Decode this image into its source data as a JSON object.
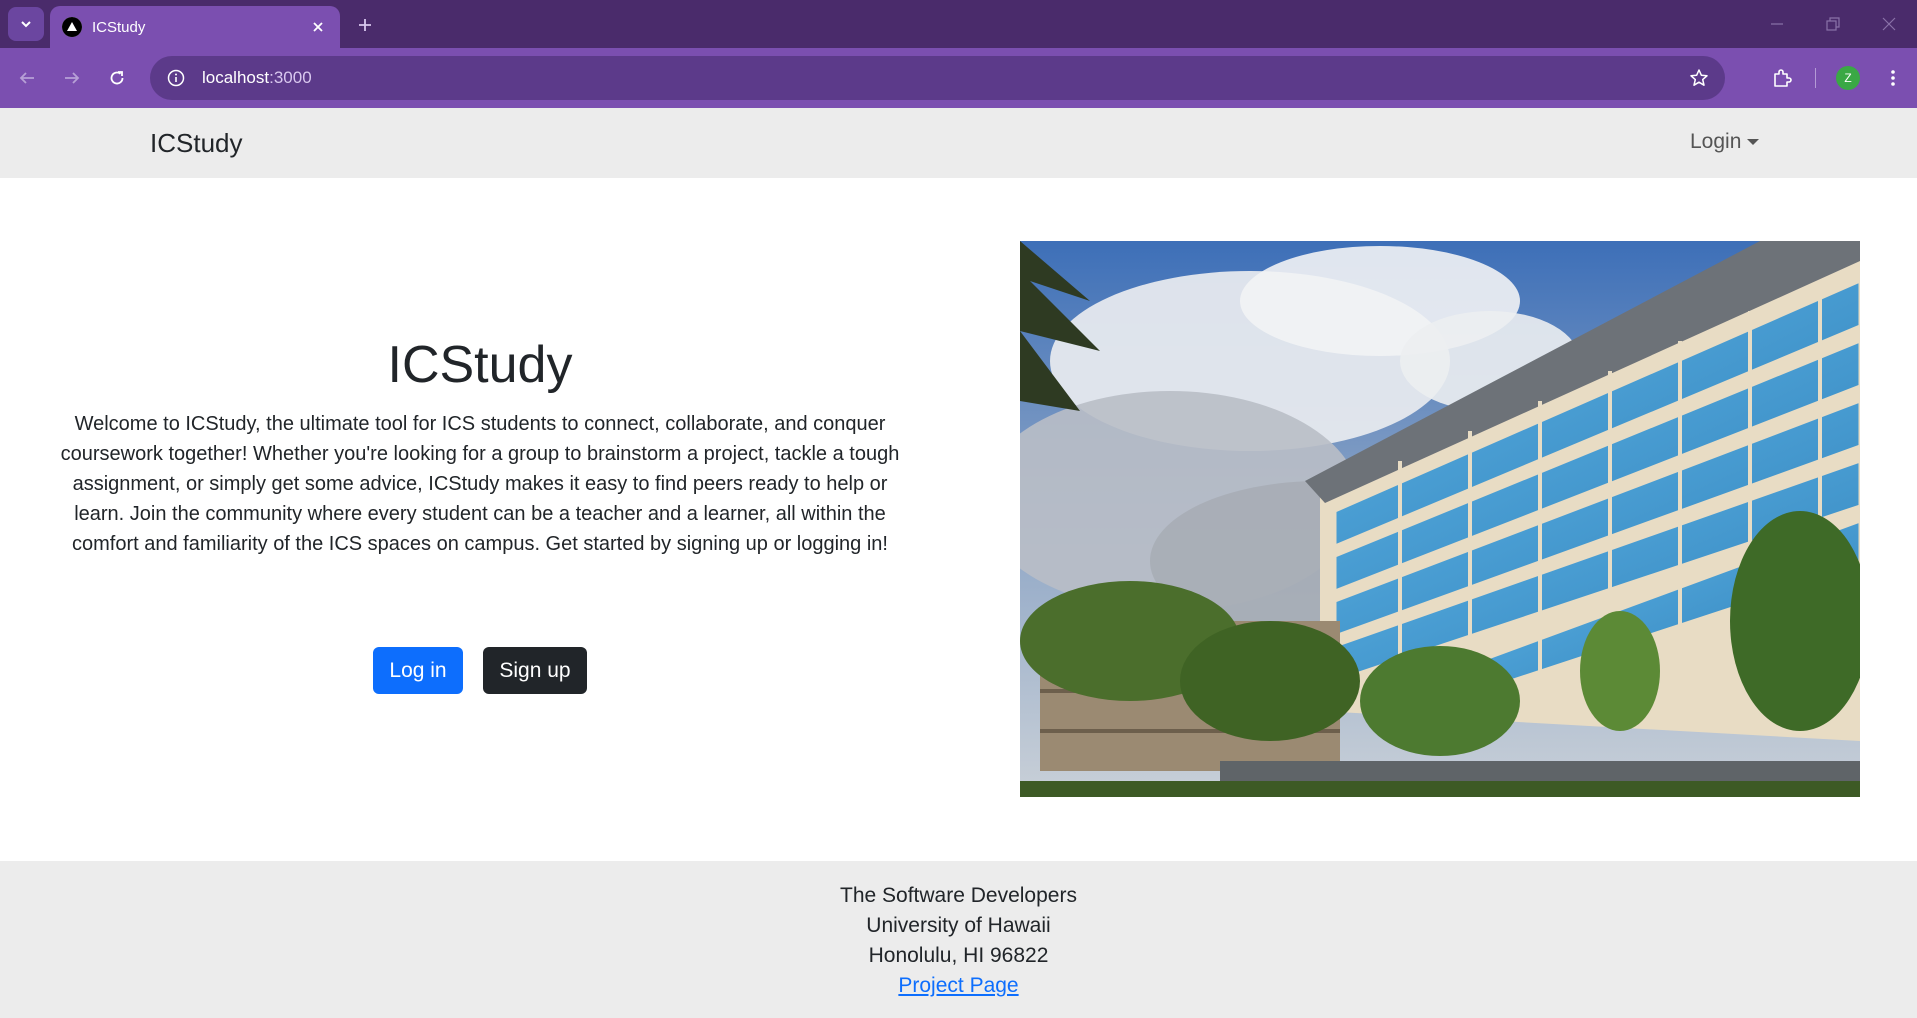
{
  "browser": {
    "tab_title": "ICStudy",
    "url_host": "localhost",
    "url_port": ":3000",
    "profile_initial": "Z"
  },
  "navbar": {
    "brand": "ICStudy",
    "login_label": "Login"
  },
  "hero": {
    "title": "ICStudy",
    "description": "Welcome to ICStudy, the ultimate tool for ICS students to connect, collaborate, and conquer coursework together! Whether you're looking for a group to brainstorm a project, tackle a tough assignment, or simply get some advice, ICStudy makes it easy to find peers ready to help or learn. Join the community where every student can be a teacher and a learner, all within the comfort and familiarity of the ICS spaces on campus. Get started by signing up or logging in!",
    "login_button": "Log in",
    "signup_button": "Sign up"
  },
  "footer": {
    "line1": "The Software Developers",
    "line2": "University of Hawaii",
    "line3": "Honolulu, HI 96822",
    "link_label": "Project Page"
  },
  "colors": {
    "chrome_dark": "#4a2b6b",
    "chrome": "#7b4fb0",
    "primary": "#0d6efd",
    "dark": "#212529",
    "nav_bg": "#ececec"
  }
}
